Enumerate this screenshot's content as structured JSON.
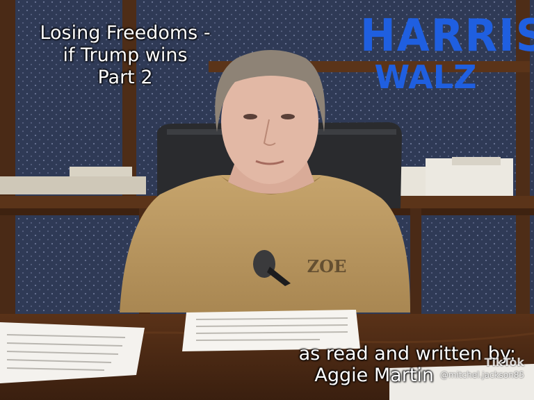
{
  "video_title": [
    "Losing Freedoms -",
    "if Trump wins",
    "Part 2"
  ],
  "campaign_logo": {
    "top": "HARRIS",
    "bottom": "WALZ",
    "color": "#1f5fe0"
  },
  "credit": {
    "line1": "as read and written by:",
    "line2": "Aggie Martin"
  },
  "watermark": {
    "platform": "TikTok",
    "handle": "@mitchel.jackson85"
  },
  "shirt_logo_text": "ZOE"
}
